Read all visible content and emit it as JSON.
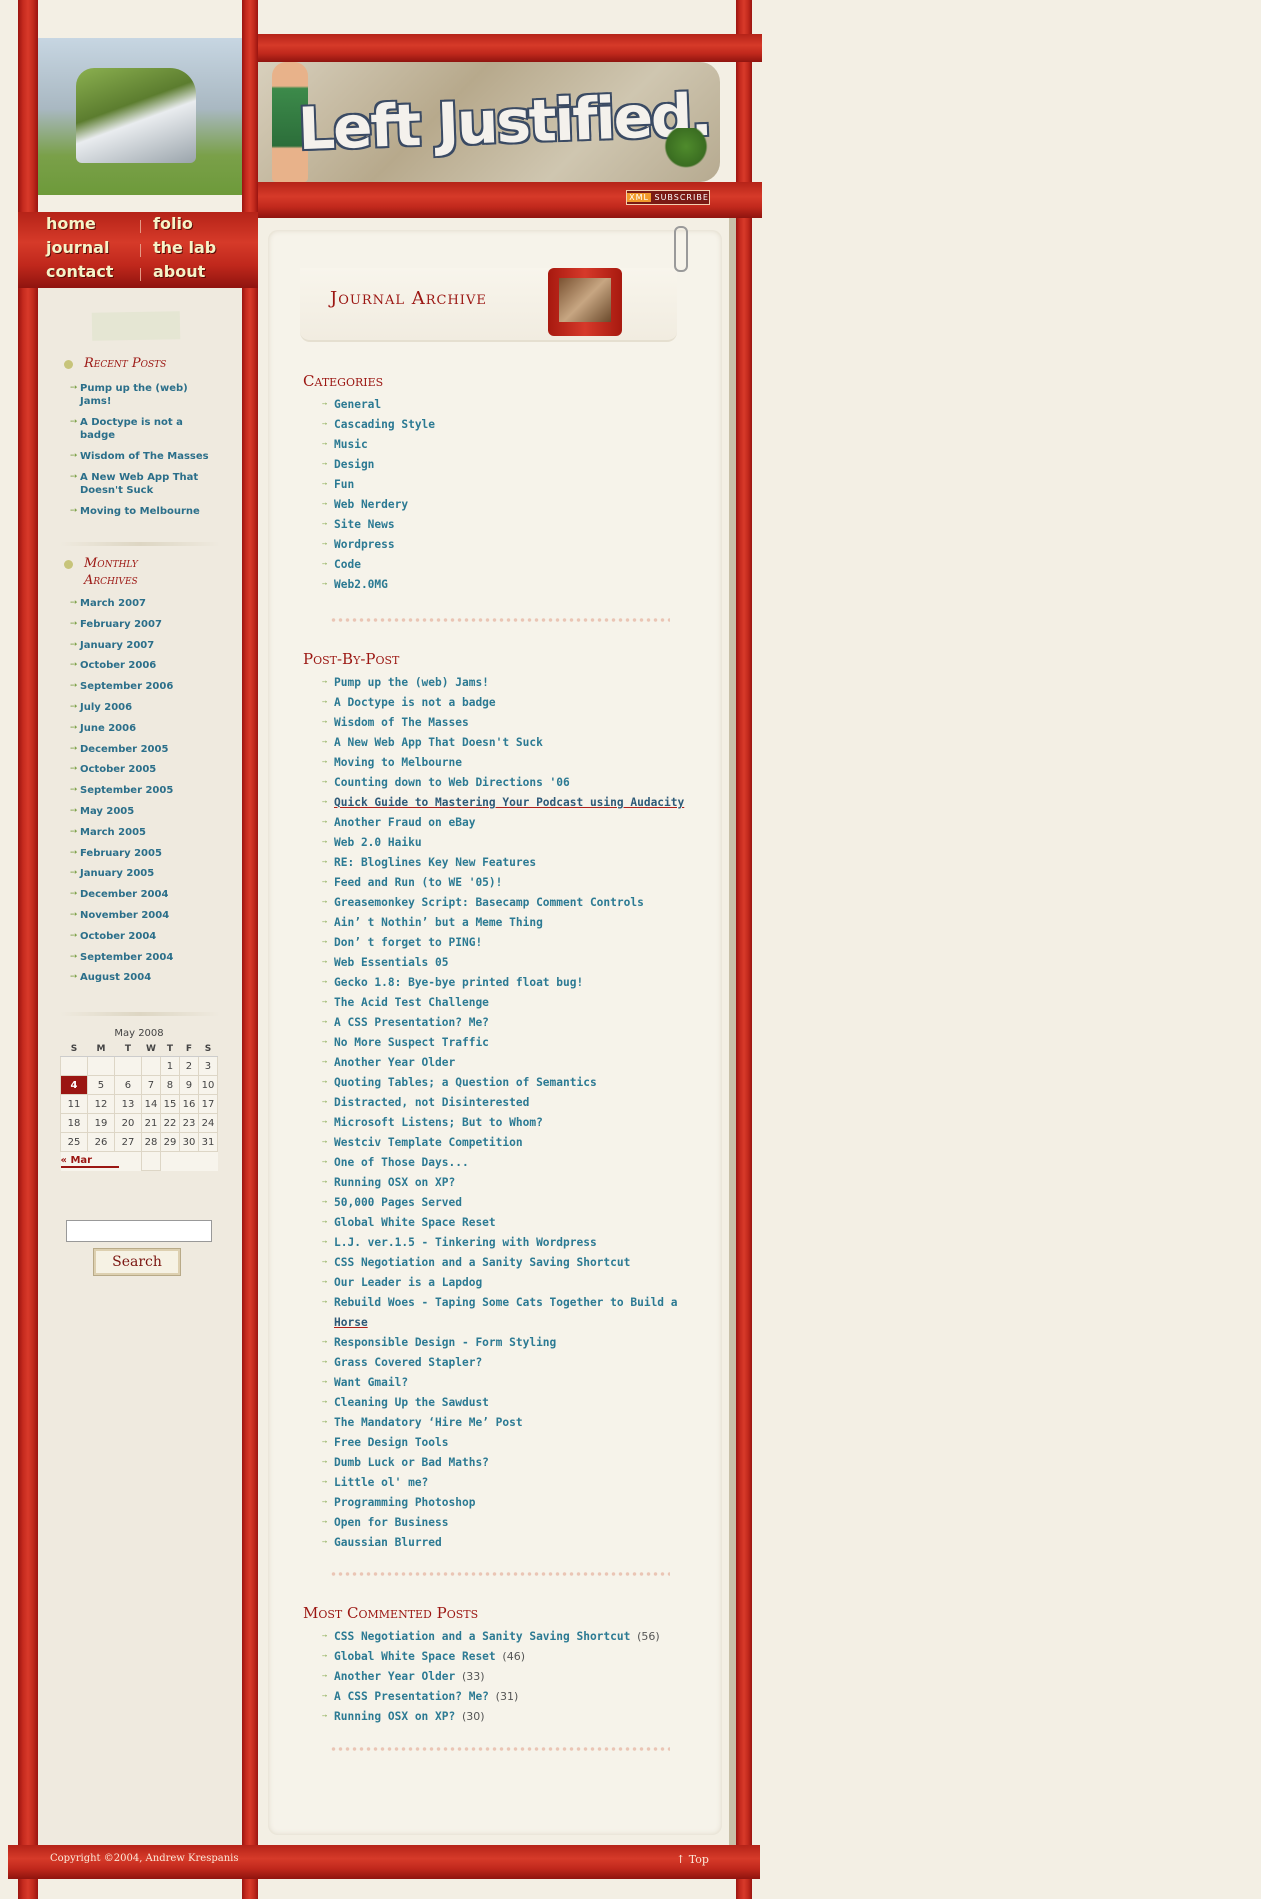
{
  "site": {
    "logo_text": "Left Justified.",
    "subscribe_label": "SUBSCRIBE",
    "subscribe_badge": "XML"
  },
  "nav": {
    "items": [
      {
        "label": "home"
      },
      {
        "label": "folio"
      },
      {
        "label": "journal"
      },
      {
        "label": "the lab"
      },
      {
        "label": "contact"
      },
      {
        "label": "about"
      }
    ]
  },
  "sidebar": {
    "recent_title": "Recent Posts",
    "recent": [
      "Pump up the (web) Jams!",
      "A Doctype is not a badge",
      "Wisdom of The Masses",
      "A New Web App That Doesn't Suck",
      "Moving to Melbourne"
    ],
    "archives_title": "Monthly Archives",
    "archives": [
      "March 2007",
      "February 2007",
      "January 2007",
      "October 2006",
      "September 2006",
      "July 2006",
      "June 2006",
      "December 2005",
      "October 2005",
      "September 2005",
      "May 2005",
      "March 2005",
      "February 2005",
      "January 2005",
      "December 2004",
      "November 2004",
      "October 2004",
      "September 2004",
      "August 2004"
    ],
    "calendar": {
      "caption": "May 2008",
      "days": [
        "S",
        "M",
        "T",
        "W",
        "T",
        "F",
        "S"
      ],
      "weeks": [
        [
          "",
          "",
          "",
          "",
          "1",
          "2",
          "3"
        ],
        [
          "4",
          "5",
          "6",
          "7",
          "8",
          "9",
          "10"
        ],
        [
          "11",
          "12",
          "13",
          "14",
          "15",
          "16",
          "17"
        ],
        [
          "18",
          "19",
          "20",
          "21",
          "22",
          "23",
          "24"
        ],
        [
          "25",
          "26",
          "27",
          "28",
          "29",
          "30",
          "31"
        ]
      ],
      "today": "4",
      "prev": "« Mar"
    },
    "search_button": "Search",
    "search_value": ""
  },
  "main": {
    "page_title": "Journal Archive",
    "categories_title": "Categories",
    "categories": [
      "General",
      "Cascading Style",
      "Music",
      "Design",
      "Fun",
      "Web Nerdery",
      "Site News",
      "Wordpress",
      "Code",
      "Web2.0MG"
    ],
    "posts_title": "Post-By-Post",
    "posts": [
      "Pump up the (web) Jams!",
      "A Doctype is not a badge",
      "Wisdom of The Masses",
      "A New Web App That Doesn't Suck",
      "Moving to Melbourne",
      "Counting down to Web Directions '06",
      "Quick Guide to Mastering Your Podcast using Audacity",
      "Another Fraud on eBay",
      "Web 2.0 Haiku",
      "RE: Bloglines Key New Features",
      "Feed and Run (to WE '05)!",
      "Greasemonkey Script: Basecamp Comment Controls",
      "Ain’ t Nothin’ but a Meme Thing",
      "Don’ t forget to PING!",
      "Web Essentials 05",
      "Gecko 1.8: Bye-bye printed float bug!",
      "The Acid Test Challenge",
      "A CSS Presentation? Me?",
      "No More Suspect Traffic",
      "Another Year Older",
      "Quoting Tables; a Question of Semantics",
      "Distracted, not Disinterested",
      "Microsoft Listens; But to Whom?",
      "Westciv Template Competition",
      "One of Those Days...",
      "Running OSX on XP?",
      "50,000 Pages Served",
      "Global White Space Reset",
      "L.J. ver.1.5 - Tinkering with Wordpress",
      "CSS Negotiation and a Sanity Saving Shortcut",
      "Our Leader is a Lapdog",
      "Rebuild Woes - Taping Some Cats Together to Build a",
      "Horse",
      "Responsible Design - Form Styling",
      "Grass Covered Stapler?",
      "Want Gmail?",
      "Cleaning Up the Sawdust",
      "The Mandatory ‘Hire Me’ Post",
      "Free Design Tools",
      "Dumb Luck or Bad Maths?",
      "Little ol' me?",
      "Programming Photoshop",
      "Open for Business",
      "Gaussian Blurred"
    ],
    "most_title": "Most Commented Posts",
    "most": [
      {
        "title": "CSS Negotiation and a Sanity Saving Shortcut",
        "count": "(56)"
      },
      {
        "title": "Global White Space Reset",
        "count": "(46)"
      },
      {
        "title": "Another Year Older",
        "count": "(33)"
      },
      {
        "title": "A CSS Presentation? Me?",
        "count": "(31)"
      },
      {
        "title": "Running OSX on XP?",
        "count": "(30)"
      }
    ]
  },
  "footer": {
    "copyright": "Copyright ©2004, Andrew Krespanis",
    "top_label": "↑ Top"
  }
}
